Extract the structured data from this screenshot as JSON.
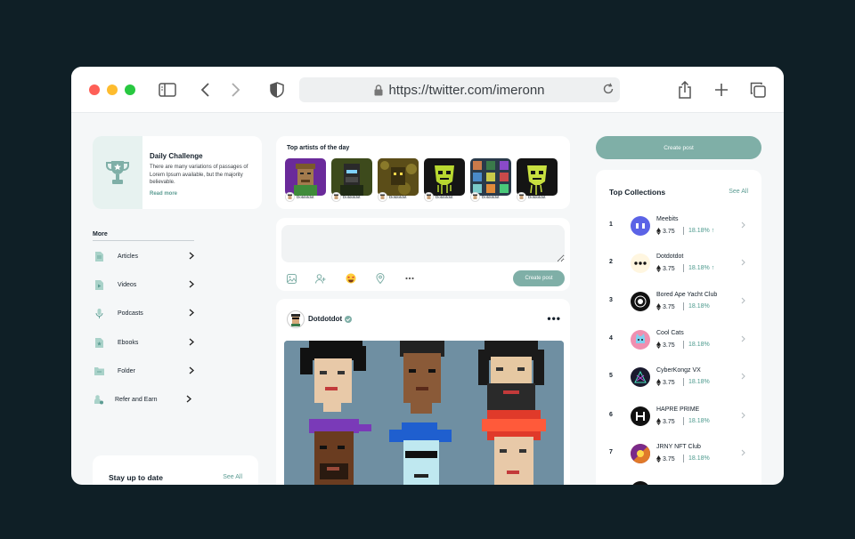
{
  "browser": {
    "url": "https://twitter.com/imeronn"
  },
  "challenge": {
    "title": "Daily Challenge",
    "description": "There are many variations of passages of Lorem Ipsum available, but the majority believable.",
    "link": "Read more"
  },
  "more": {
    "heading": "More",
    "items": [
      {
        "label": "Articles",
        "icon": "document-icon"
      },
      {
        "label": "Videos",
        "icon": "video-file-icon"
      },
      {
        "label": "Podcasts",
        "icon": "microphone-icon"
      },
      {
        "label": "Ebooks",
        "icon": "ebook-icon"
      },
      {
        "label": "Folder",
        "icon": "folder-icon"
      },
      {
        "label": "Refer and Earn",
        "icon": "refer-icon"
      }
    ]
  },
  "stay": {
    "title": "Stay up to date",
    "see_all": "See All"
  },
  "artists": {
    "title": "Top artists of the day",
    "items": [
      {
        "name": "Dotdotdot",
        "bg": "#6a2a9a"
      },
      {
        "name": "Dotdotdot",
        "bg": "#3d4a1c"
      },
      {
        "name": "Dotdotdot",
        "bg": "#6b5a1f"
      },
      {
        "name": "Dotdotdot",
        "bg": "#151515"
      },
      {
        "name": "Dotdotdot",
        "bg": "#2a3a4a"
      },
      {
        "name": "Dotdotdot",
        "bg": "#141414"
      }
    ]
  },
  "composer": {
    "button": "Create post",
    "icons": [
      "image-icon",
      "tag-user-icon",
      "emoji-icon",
      "location-icon",
      "more-icon"
    ]
  },
  "post": {
    "user": "Dotdotdot",
    "verified": true
  },
  "right": {
    "create_post": "Create post",
    "title": "Top Collections",
    "see_all": "See All",
    "items": [
      {
        "rank": "1",
        "name": "Meebits",
        "price": "3.75",
        "change": "18.18%",
        "arrow": "↑",
        "logo_color": "#5b63e6"
      },
      {
        "rank": "2",
        "name": "Dotdotdot",
        "price": "3.75",
        "change": "18.18%",
        "arrow": "↑",
        "logo_color": "#fff6e0"
      },
      {
        "rank": "3",
        "name": "Bored Ape Yacht Club",
        "price": "3.75",
        "change": "18.18%",
        "arrow": "",
        "logo_color": "#111111"
      },
      {
        "rank": "4",
        "name": "Cool Cats",
        "price": "3.75",
        "change": "18.18%",
        "arrow": "",
        "logo_color": "#f08fb0"
      },
      {
        "rank": "5",
        "name": "CyberKongz VX",
        "price": "3.75",
        "change": "18.18%",
        "arrow": "",
        "logo_color": "#1a1a2e"
      },
      {
        "rank": "6",
        "name": "HAPRE PRIME",
        "price": "3.75",
        "change": "18.18%",
        "arrow": "",
        "logo_color": "#111111"
      },
      {
        "rank": "7",
        "name": "JRNY NFT Club",
        "price": "3.75",
        "change": "18.18%",
        "arrow": "",
        "logo_color": "#c2442b"
      }
    ]
  },
  "colors": {
    "accent": "#7fafa7",
    "link": "#5c9c93",
    "background": "#0f1f26"
  }
}
